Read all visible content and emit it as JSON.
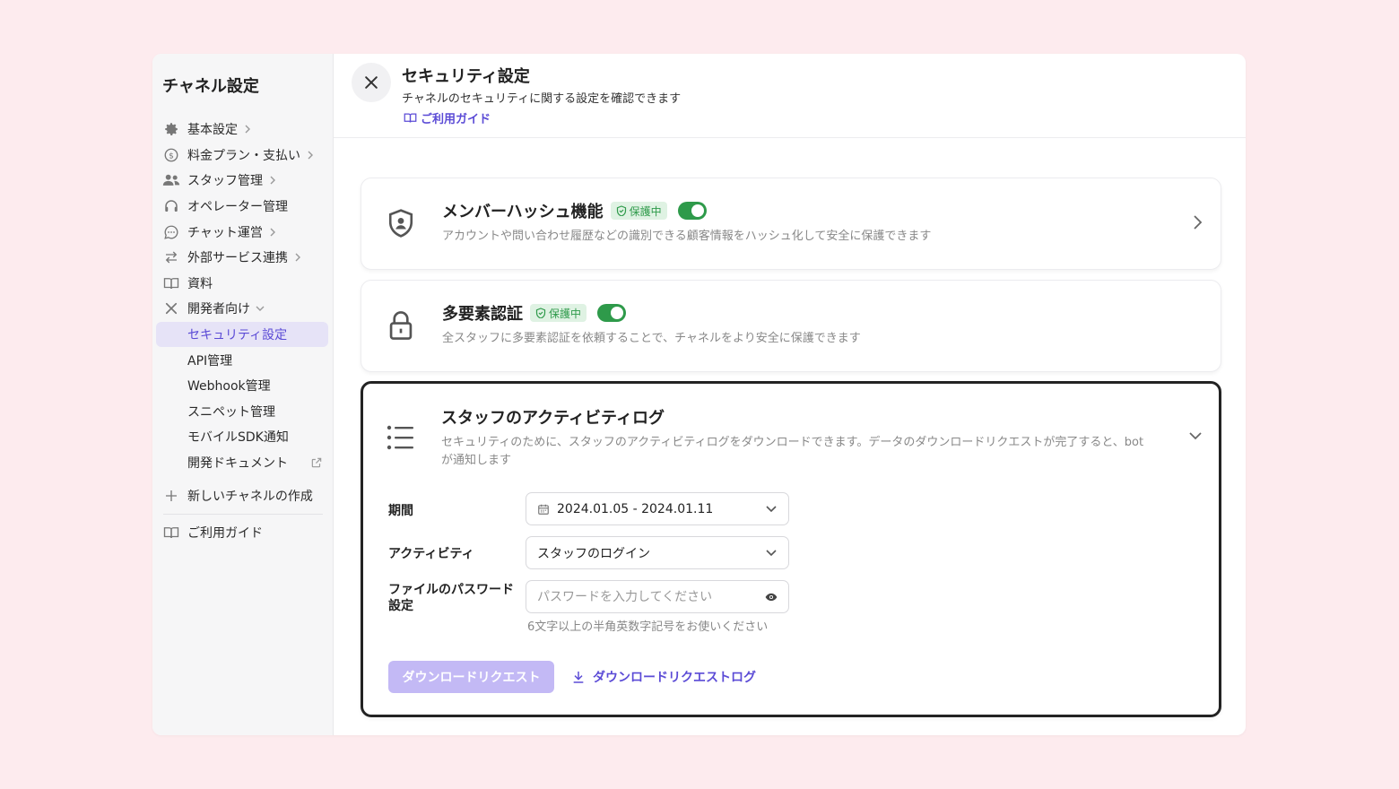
{
  "sidebar": {
    "title": "チャネル設定",
    "items": [
      {
        "label": "基本設定",
        "icon": "gear-icon"
      },
      {
        "label": "料金プラン・支払い",
        "icon": "dollar-icon"
      },
      {
        "label": "スタッフ管理",
        "icon": "users-icon"
      },
      {
        "label": "オペレーター管理",
        "icon": "headset-icon"
      },
      {
        "label": "チャット運営",
        "icon": "chat-icon"
      },
      {
        "label": "外部サービス連携",
        "icon": "swap-icon"
      },
      {
        "label": "資料",
        "icon": "book-icon"
      },
      {
        "label": "開発者向け",
        "icon": "tools-icon"
      }
    ],
    "sub_items": [
      {
        "label": "セキュリティ設定"
      },
      {
        "label": "API管理"
      },
      {
        "label": "Webhook管理"
      },
      {
        "label": "スニペット管理"
      },
      {
        "label": "モバイルSDK通知"
      },
      {
        "label": "開発ドキュメント"
      }
    ],
    "new_channel": "新しいチャネルの作成",
    "guide": "ご利用ガイド"
  },
  "header": {
    "title": "セキュリティ設定",
    "description": "チャネルのセキュリティに関する設定を確認できます",
    "guide_link": "ご利用ガイド"
  },
  "cards": {
    "hash": {
      "title": "メンバーハッシュ機能",
      "badge": "保護中",
      "enabled": true,
      "description": "アカウントや問い合わせ履歴などの識別できる顧客情報をハッシュ化して安全に保護できます"
    },
    "mfa": {
      "title": "多要素認証",
      "badge": "保護中",
      "enabled": true,
      "description": "全スタッフに多要素認証を依頼することで、チャネルをより安全に保護できます"
    },
    "activity": {
      "title": "スタッフのアクティビティログ",
      "description_line1": "セキュリティのために、スタッフのアクティビティログをダウンロードできます。データのダウンロードリクエストが完了すると、bot",
      "description_line2": "が通知します",
      "period_label": "期間",
      "period_value": "2024.01.05 - 2024.01.11",
      "activity_label": "アクティビティ",
      "activity_value": "スタッフのログイン",
      "password_label_line1": "ファイルのパスワード",
      "password_label_line2": "設定",
      "password_placeholder": "パスワードを入力してください",
      "password_hint": "6文字以上の半角英数字記号をお使いください",
      "request_button": "ダウンロードリクエスト",
      "log_link": "ダウンロードリクエストログ"
    }
  },
  "colors": {
    "accent": "#5b4bd6",
    "badge_bg": "#dff2e3",
    "badge_text": "#2e9a4a",
    "toggle_on": "#2e9a4a",
    "page_bg": "#fdebee",
    "disabled_button": "#c3b9f5"
  }
}
